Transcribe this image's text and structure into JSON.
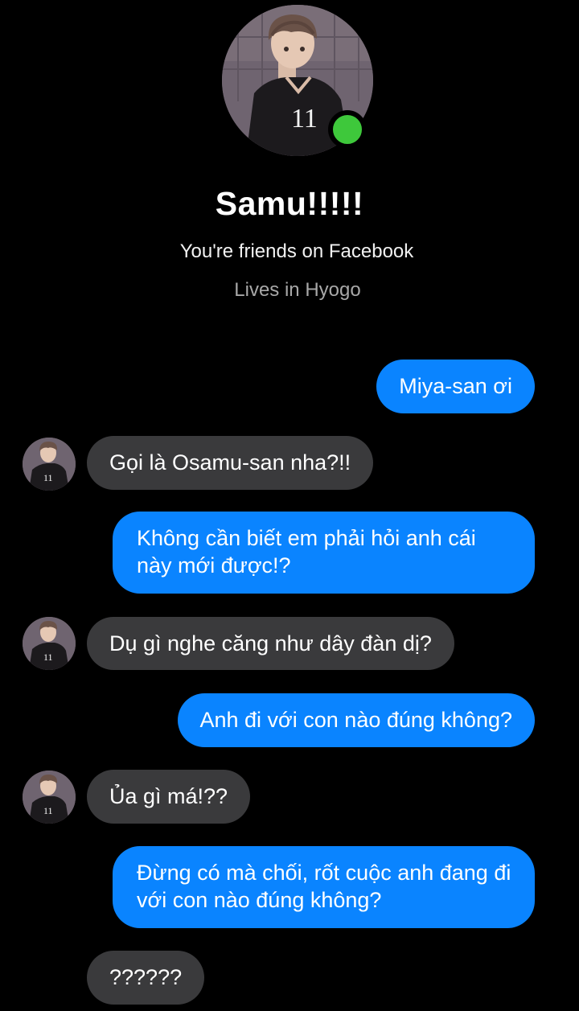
{
  "contact": {
    "name": "Samu!!!!!",
    "friend_status": "You're friends on Facebook",
    "location": "Lives in Hyogo",
    "online": true,
    "online_color": "#3ec83b",
    "avatar_jersey_number": "11"
  },
  "colors": {
    "background": "#000000",
    "outgoing_bubble": "#0a84ff",
    "incoming_bubble": "#3a3a3c"
  },
  "messages": [
    {
      "direction": "outgoing",
      "text": "Miya-san ơi"
    },
    {
      "direction": "incoming",
      "text": "Gọi là Osamu-san nha?!!"
    },
    {
      "direction": "outgoing",
      "text": "Không cần biết em phải hỏi anh cái này mới được!?"
    },
    {
      "direction": "incoming",
      "text": "Dụ gì nghe căng như dây đàn dị?"
    },
    {
      "direction": "outgoing",
      "text": "Anh đi với con nào đúng không?"
    },
    {
      "direction": "incoming",
      "text": "Ủa gì má!??"
    },
    {
      "direction": "outgoing",
      "text": "Đừng có mà chối, rốt cuộc anh đang đi với con nào đúng không?"
    },
    {
      "direction": "incoming",
      "text": "??????"
    }
  ]
}
